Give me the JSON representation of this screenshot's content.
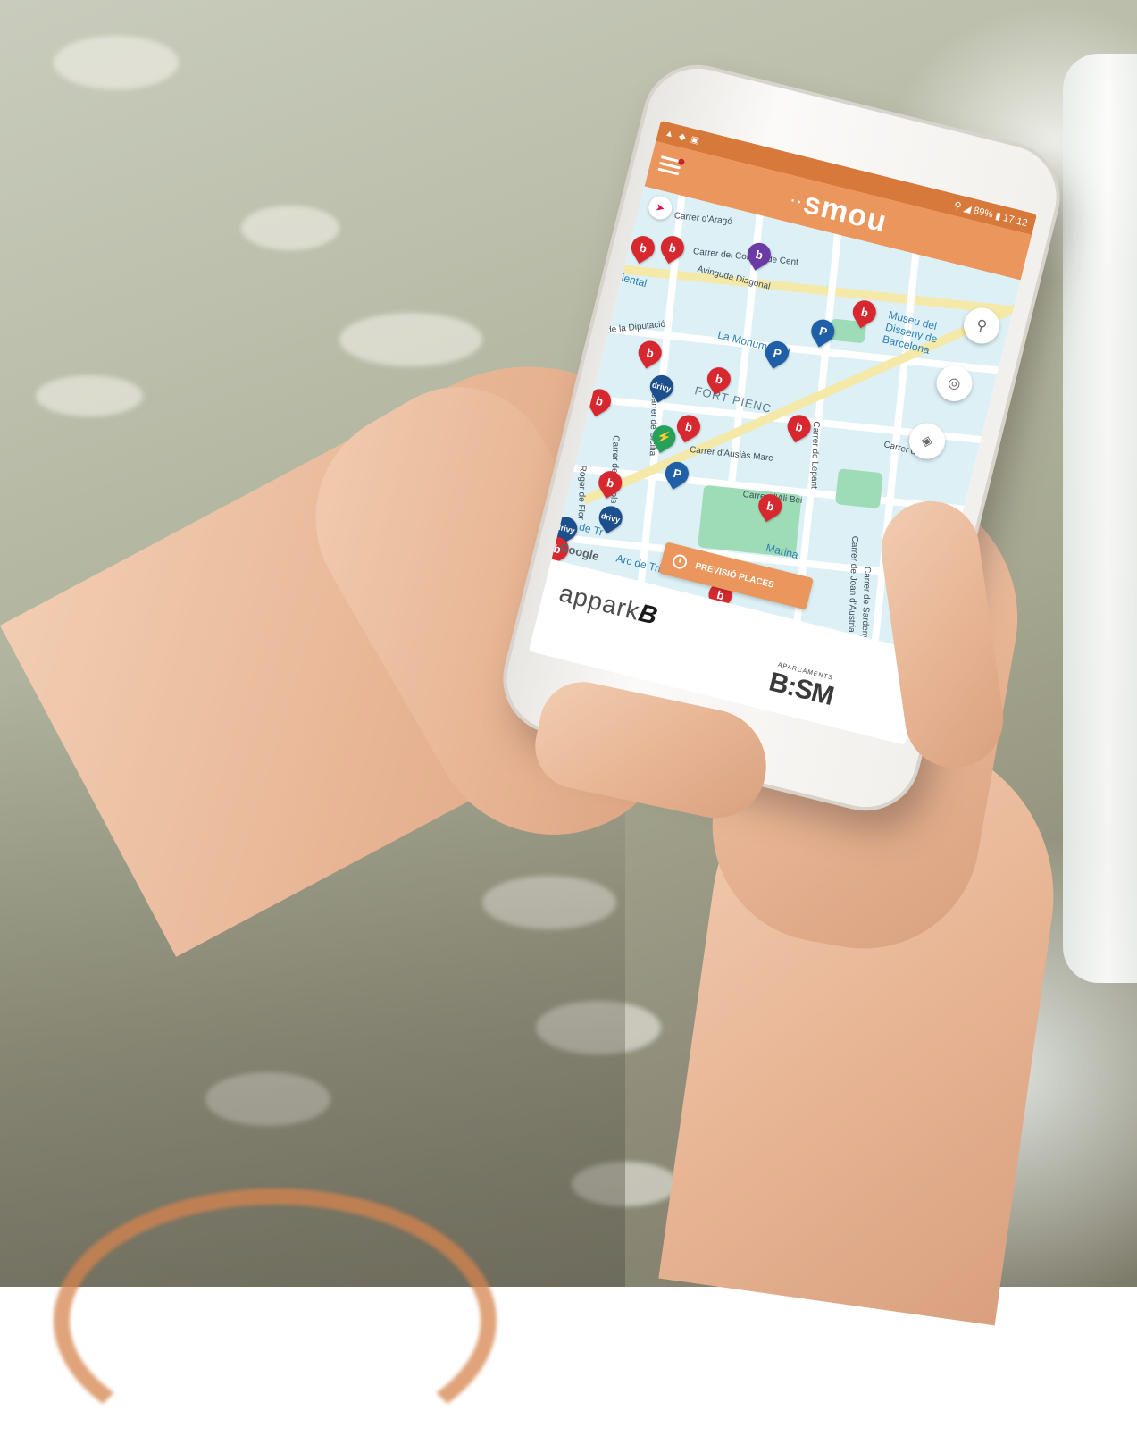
{
  "status_bar": {
    "left_icons": [
      "alert-icon",
      "notification-icon",
      "image-icon"
    ],
    "battery": "89%",
    "time": "17:12"
  },
  "app": {
    "brand_prefix": "··",
    "brand": "smou",
    "brand_color": "#ea965c"
  },
  "map": {
    "street_labels": {
      "arago": "Carrer d'Aragó",
      "consell": "Carrer del Consell de Cent",
      "diagonal": "Avinguda Diagonal",
      "museu": "Museu del Disseny de Barcelona",
      "monumental": "La Monumental",
      "diputacio": "de la Diputació",
      "fort_pienc": "FORT PIENC",
      "sicilia": "Carrer de Sicília",
      "napols": "Carrer de Nàpols",
      "ausias": "Carrer d'Ausiàs Marc",
      "ali_bei": "Carrer d'Ali Bei",
      "lepant": "Carrer de Lepant",
      "roger_flor": "Roger de Flor",
      "marina": "Marina",
      "joan_austria": "Carrer de Joan d'Àustria",
      "arc_triomf_1": "Arc de Tr",
      "arc_triomf_2": "Arc de Triomf",
      "ca": "Carrer de",
      "sardenya": "Carrer de Sardenya",
      "iental": "iental"
    },
    "pins": [
      {
        "type": "bicing",
        "glyph": "b"
      },
      {
        "type": "drivy",
        "glyph": "drivy"
      },
      {
        "type": "parking",
        "glyph": "P"
      },
      {
        "type": "charging",
        "glyph": "⚡"
      }
    ],
    "attribution": "Google",
    "forecast_button": "PREVISIÓ PLACES"
  },
  "footer": {
    "appark_prefix": "appark",
    "appark_suffix": "B",
    "bsm_caption": "APARCAMENTS",
    "bsm": "B:SM"
  },
  "colors": {
    "accent": "#ea965c",
    "status_bar": "#d8793c",
    "bicing": "#d8282f",
    "drivy": "#1d4f8d",
    "charging": "#27a15a",
    "map_water": "#dcf0f6"
  }
}
